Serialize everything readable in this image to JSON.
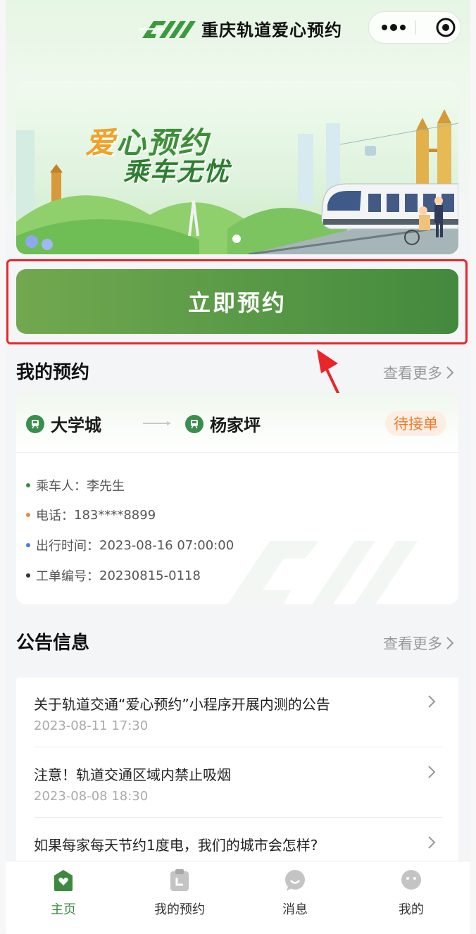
{
  "app": {
    "title": "重庆轨道爱心预约",
    "accent": "#4a9343",
    "highlight_color": "#e8262a"
  },
  "capsule": {
    "more_icon": "more-dots-icon",
    "close_icon": "target-close-icon"
  },
  "banner": {
    "slogan_line1_part1": "爱",
    "slogan_line1_part2": "心",
    "slogan_line1_part3": "预约",
    "slogan_line2": "乘车无忧",
    "slide_count": 1,
    "active_slide": 1
  },
  "reserve_button": {
    "label": "立即预约"
  },
  "my_booking": {
    "title": "我的预约",
    "see_more": "查看更多",
    "from_station": "大学城",
    "to_station": "杨家坪",
    "status": "待接单",
    "details": [
      {
        "label": "乘车人：",
        "value": "李先生",
        "dot_color": "#3d8a3f"
      },
      {
        "label": "电话：",
        "value": "183****8899",
        "dot_color": "#f0883a"
      },
      {
        "label": "出行时间：",
        "value": "2023-08-16 07:00:00",
        "dot_color": "#4a7de0"
      },
      {
        "label": "工单编号：",
        "value": "20230815-0118",
        "dot_color": "#333333"
      }
    ]
  },
  "notices": {
    "title": "公告信息",
    "see_more": "查看更多",
    "items": [
      {
        "title": "关于轨道交通“爱心预约”小程序开展内测的公告",
        "date": "2023-08-11 17:30"
      },
      {
        "title": "注意！轨道交通区域内禁止吸烟",
        "date": "2023-08-08 18:30"
      },
      {
        "title": "如果每家每天节约1度电，我们的城市会怎样?",
        "date": ""
      }
    ]
  },
  "tabs": [
    {
      "label": "主页",
      "icon": "home-heart-icon",
      "active": true
    },
    {
      "label": "我的预约",
      "icon": "clipboard-icon",
      "active": false
    },
    {
      "label": "消息",
      "icon": "message-smile-icon",
      "active": false
    },
    {
      "label": "我的",
      "icon": "user-face-icon",
      "active": false
    }
  ]
}
